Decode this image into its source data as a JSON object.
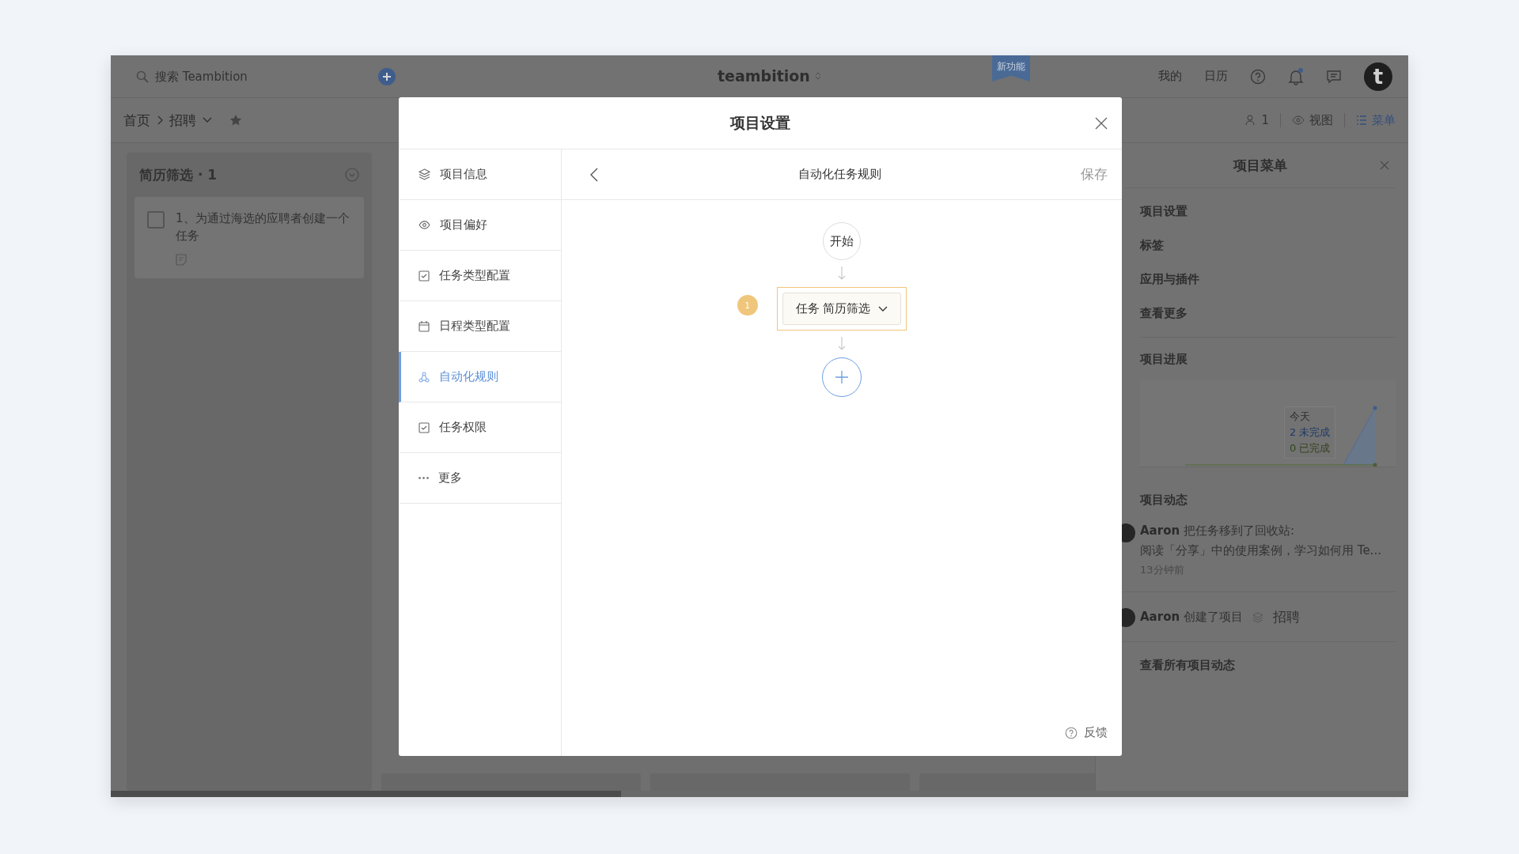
{
  "topbar": {
    "search": {
      "placeholder": "搜索 Teambition"
    },
    "logo": "teambition",
    "new_badge": "新功能",
    "links": [
      "我的",
      "日历"
    ],
    "avatar": "t"
  },
  "toolbar": {
    "breadcrumb": [
      "首页",
      "招聘"
    ],
    "members": "1",
    "view": "视图",
    "menu": "菜单"
  },
  "column": {
    "title": "简历筛选 · 1",
    "task": {
      "text": "1、为通过海选的应聘者创建一个任务",
      "checked": false
    }
  },
  "modal": {
    "title": "项目设置",
    "nav": [
      {
        "kind": "layers",
        "label": "项目信息",
        "selected": false
      },
      {
        "kind": "eye",
        "label": "项目偏好",
        "selected": false
      },
      {
        "kind": "check",
        "label": "任务类型配置",
        "selected": false
      },
      {
        "kind": "calendar",
        "label": "日程类型配置",
        "selected": false
      },
      {
        "kind": "robot",
        "label": "自动化规则",
        "selected": true
      },
      {
        "kind": "check",
        "label": "任务权限",
        "selected": false
      },
      {
        "kind": "more",
        "label": "更多",
        "selected": false
      }
    ],
    "panel": {
      "title": "自动化任务规则",
      "save": "保存",
      "start": "开始",
      "step": {
        "badge": "1",
        "label": "任务 简历筛选"
      },
      "feedback": "反馈"
    }
  },
  "side_panel": {
    "title": "项目菜单",
    "items": [
      "项目设置",
      "标签",
      "应用与插件",
      "查看更多"
    ],
    "progress": {
      "title": "项目进展",
      "tooltip": {
        "day": "今天",
        "open": "2 未完成",
        "done": "0 已完成"
      }
    },
    "activity": {
      "title": "项目动态",
      "entries": [
        {
          "user": "Aaron",
          "text": "把任务移到了回收站:",
          "detail": "阅读「分享」中的使用案例，学习如何用 Te...",
          "time": "13分钟前"
        },
        {
          "user": "Aaron",
          "text": "创建了项目",
          "project": "招聘"
        }
      ],
      "all": "查看所有项目动态"
    }
  }
}
